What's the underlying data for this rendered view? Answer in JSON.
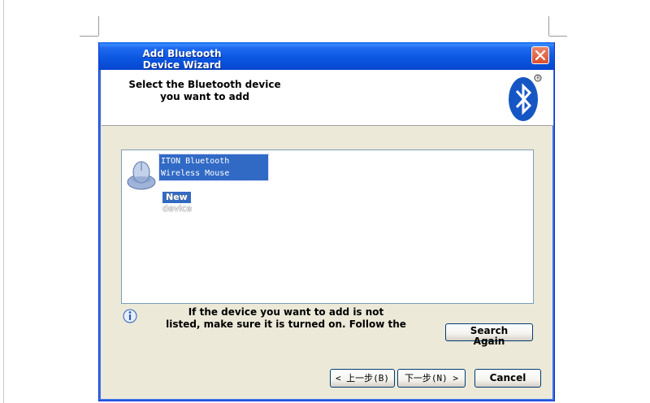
{
  "window": {
    "title_line1": "Add Bluetooth",
    "title_line2": "Device Wizard"
  },
  "header": {
    "line1": "Select the Bluetooth device",
    "line2": "you want to add"
  },
  "devices": [
    {
      "name_line1": "ITON Bluetooth",
      "name_line2": "Wireless Mouse",
      "status": "New",
      "status_sub": "device"
    }
  ],
  "info": {
    "line1": "If the device you want to add is not",
    "line2": "listed, make sure it is turned on. Follow the"
  },
  "buttons": {
    "search_line1": "Search",
    "search_line2": "Again",
    "back": "< 上一步(B)",
    "next": "下一步(N) >",
    "cancel": "Cancel"
  },
  "colors": {
    "titlebar": "#0a55e0",
    "selection": "#316ac5",
    "window_bg": "#ece9d8",
    "bluetooth": "#1656c4"
  },
  "icons": {
    "close": "close-icon",
    "bluetooth": "bluetooth-logo-icon",
    "device": "mouse-device-icon",
    "info": "info-icon"
  }
}
